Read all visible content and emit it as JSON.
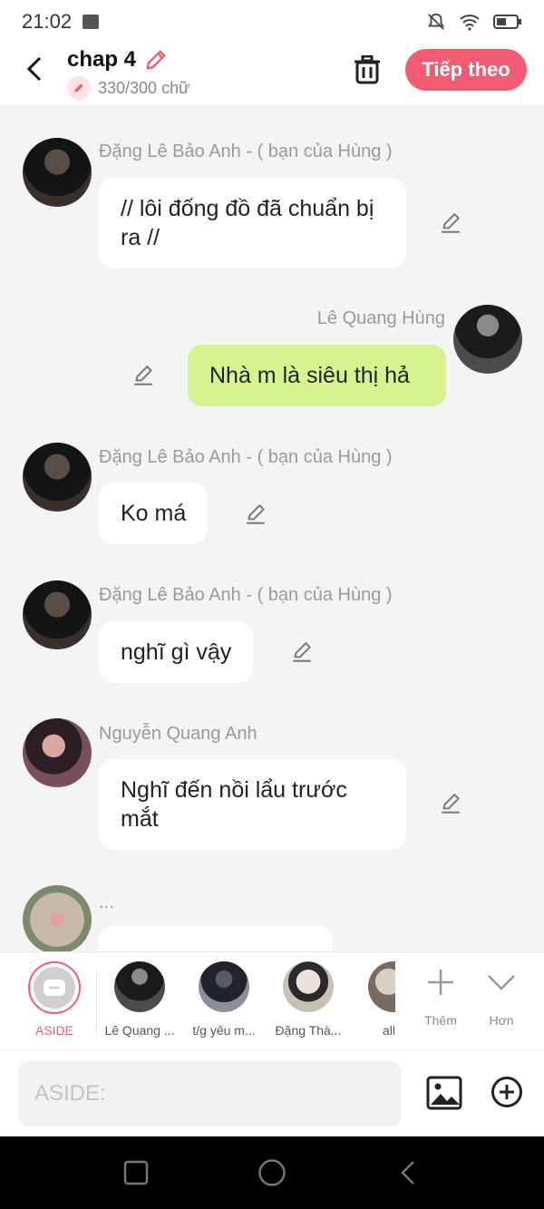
{
  "status_bar": {
    "time": "21:02"
  },
  "header": {
    "title": "chap 4",
    "char_count": "330/300 chữ",
    "next_button": "Tiếp theo"
  },
  "messages": [
    {
      "sender": "Đặng Lê Bảo Anh - ( bạn của Hùng )",
      "text": "// lôi đống đồ đã chuẩn bị ra //",
      "side": "left"
    },
    {
      "sender": "Lê Quang Hùng",
      "text": "Nhà m là siêu thị hả",
      "side": "right"
    },
    {
      "sender": "Đặng Lê Bảo Anh - ( bạn của Hùng )",
      "text": "Ko má",
      "side": "left"
    },
    {
      "sender": "Đặng Lê Bảo Anh - ( bạn của Hùng )",
      "text": "nghĩ gì vậy",
      "side": "left"
    },
    {
      "sender": "Nguyễn Quang Anh",
      "text": "Nghĩ đến nồi lẩu trước mắt",
      "side": "left"
    },
    {
      "sender": "...",
      "text": "",
      "side": "left"
    }
  ],
  "characters": {
    "aside_label": "ASIDE",
    "items": [
      "Lê Quang ...",
      "t/g yêu m...",
      "Đặng Thà...",
      "all"
    ],
    "more_label": "Thêm",
    "collapse_label": "Hơn"
  },
  "input": {
    "placeholder": "ASIDE:"
  },
  "colors": {
    "accent": "#f25c73",
    "mine_bubble": "#d5f38f",
    "background": "#f4f4f4"
  }
}
